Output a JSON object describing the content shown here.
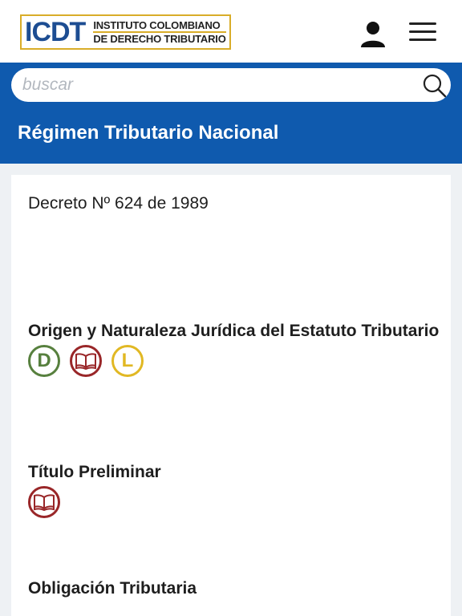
{
  "header": {
    "logo": {
      "mark": "ICDT",
      "line1": "INSTITUTO COLOMBIANO",
      "line2": "DE DERECHO TRIBUTARIO"
    },
    "icons": {
      "user": "user-icon",
      "menu": "hamburger-menu-icon"
    }
  },
  "search": {
    "placeholder": "buscar",
    "icon": "search-icon"
  },
  "page_title": "Régimen Tributario Nacional",
  "content": {
    "decree": "Decreto Nº 624 de 1989",
    "sections": [
      {
        "title": "Origen y Naturaleza Jurídica del Estatuto Tributario",
        "badges": [
          "D",
          "book",
          "L"
        ]
      },
      {
        "title": "Título Preliminar",
        "badges": [
          "book"
        ]
      },
      {
        "title": "Obligación Tributaria",
        "badges": []
      }
    ]
  },
  "colors": {
    "brand_blue": "#0f5aae",
    "logo_gold": "#d9ad29",
    "badge_green": "#57803e",
    "badge_red": "#992628",
    "badge_yellow": "#e1b823"
  }
}
